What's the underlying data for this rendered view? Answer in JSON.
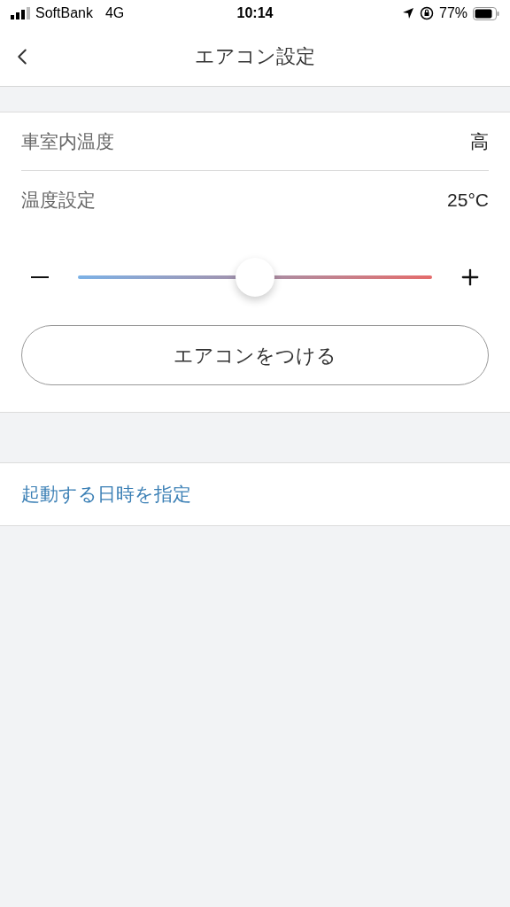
{
  "status_bar": {
    "carrier": "SoftBank",
    "network": "4G",
    "time": "10:14",
    "battery": "77%"
  },
  "nav": {
    "title": "エアコン設定"
  },
  "settings": [
    {
      "kind": "value",
      "label": "車室内温度",
      "value": "高"
    },
    {
      "kind": "value",
      "label": "温度設定",
      "value": "25°C"
    },
    {
      "kind": "slider",
      "level": 0.5
    }
  ],
  "action_button": "エアコンをつける",
  "schedule_link": "起動する日時を指定"
}
